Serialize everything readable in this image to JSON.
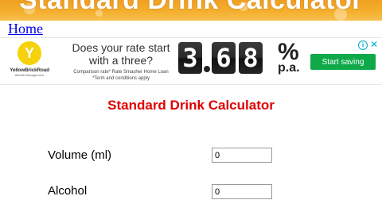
{
  "banner": {
    "title": "Standard Drink Calculator"
  },
  "nav": {
    "home_label": "Home"
  },
  "ad": {
    "logo_letter": "Y",
    "logo_name": "YellowBrickRoad",
    "logo_sub": "Wealth Management",
    "headline": "Does your rate start with a three?",
    "fine_print_1": "Comparison rate* Rate Smasher Home Loan",
    "fine_print_2": "*Term and conditions apply",
    "rate_digits": [
      "3",
      "6",
      "8"
    ],
    "rate_symbol": "%",
    "rate_suffix": "p.a.",
    "cta_label": "Start saving",
    "info_icon_glyph": "i",
    "close_icon_glyph": "✕",
    "cta_color": "#10a94a"
  },
  "page": {
    "title": "Standard Drink Calculator",
    "title_color": "#e00000"
  },
  "form": {
    "volume": {
      "label": "Volume (ml)",
      "value": "0"
    },
    "alcohol": {
      "label": "Alcohol",
      "value": "0"
    }
  }
}
